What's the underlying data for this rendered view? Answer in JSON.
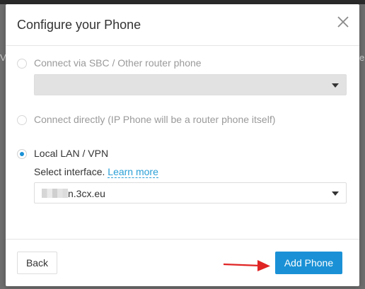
{
  "dialog": {
    "title": "Configure your Phone",
    "close_icon": "close-icon"
  },
  "options": [
    {
      "label": "Connect via SBC / Other router phone",
      "selected": false,
      "disabled": true,
      "dropdown_value": ""
    },
    {
      "label": "Connect directly (IP Phone will be a router phone itself)",
      "selected": false,
      "disabled": true
    },
    {
      "label": "Local LAN / VPN",
      "selected": true,
      "disabled": false
    }
  ],
  "interface": {
    "label": "Select interface.",
    "learn_more": "Learn more",
    "selected_value": "n.3cx.eu"
  },
  "footer": {
    "back_label": "Back",
    "add_label": "Add Phone"
  },
  "colors": {
    "accent": "#1a91d6",
    "link": "#2a9fd6",
    "annotation_arrow": "#e02424"
  }
}
